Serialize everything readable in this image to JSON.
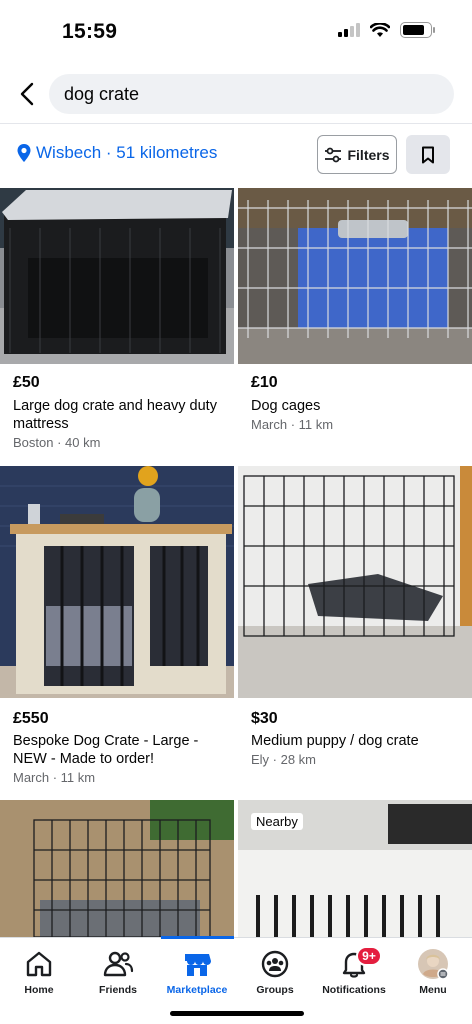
{
  "status_bar": {
    "time": "15:59"
  },
  "search": {
    "query": "dog crate"
  },
  "location": {
    "label": "Wisbech · 51 kilometres"
  },
  "toolbar": {
    "filters_label": "Filters"
  },
  "listings": [
    {
      "price": "£50",
      "title": "Large dog crate and heavy duty mattress",
      "meta": "Boston · 40 km"
    },
    {
      "price": "£10",
      "title": "Dog cages",
      "meta": "March · 11 km"
    },
    {
      "price": "£550",
      "title": "Bespoke Dog Crate - Large - NEW - Made to order!",
      "meta": "March · 11 km"
    },
    {
      "price": "$30",
      "title": "Medium puppy / dog crate",
      "meta": "Ely · 28 km"
    },
    {
      "price": "",
      "title": "",
      "meta": ""
    },
    {
      "price": "",
      "title": "",
      "meta": "",
      "badge": "Nearby"
    }
  ],
  "nav": {
    "items": [
      {
        "label": "Home",
        "icon": "home-icon"
      },
      {
        "label": "Friends",
        "icon": "friends-icon"
      },
      {
        "label": "Marketplace",
        "icon": "marketplace-icon",
        "active": true
      },
      {
        "label": "Groups",
        "icon": "groups-icon"
      },
      {
        "label": "Notifications",
        "icon": "bell-icon",
        "badge": "9+"
      },
      {
        "label": "Menu",
        "icon": "avatar"
      }
    ]
  },
  "colors": {
    "accent": "#0a66e8",
    "badge": "#e41e3f",
    "meta_text": "#65676b"
  }
}
